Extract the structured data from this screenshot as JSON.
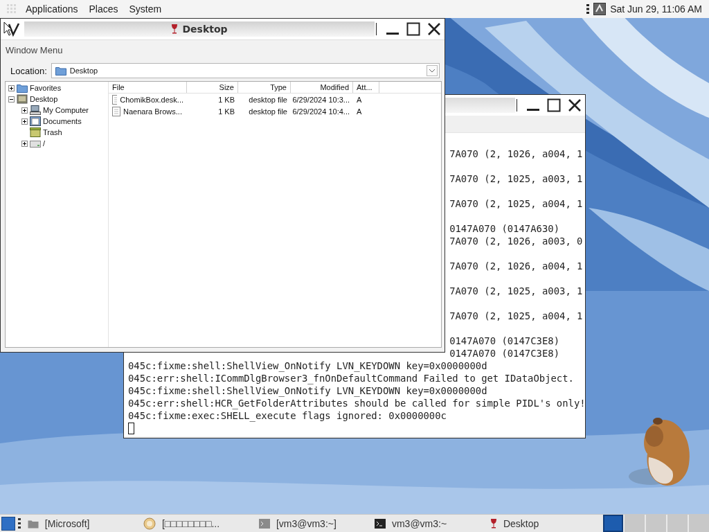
{
  "top_panel": {
    "menus": [
      "Applications",
      "Places",
      "System"
    ],
    "clock": "Sat Jun 29, 11:06 AM"
  },
  "file_window": {
    "title": "Desktop",
    "menu": "Window Menu",
    "location_label": "Location:",
    "location": "Desktop",
    "tree": [
      {
        "label": "Favorites",
        "kind": "folder",
        "expanded": false
      },
      {
        "label": "Desktop",
        "kind": "desktop",
        "expanded": true,
        "children": [
          {
            "label": "My Computer",
            "kind": "computer",
            "expanded": false
          },
          {
            "label": "Documents",
            "kind": "documents",
            "expanded": false
          },
          {
            "label": "Trash",
            "kind": "trash"
          },
          {
            "label": "/",
            "kind": "drive",
            "expanded": false
          }
        ]
      }
    ],
    "columns": [
      "File",
      "Size",
      "Type",
      "Modified",
      "Att..."
    ],
    "rows": [
      {
        "file": "ChomikBox.desk...",
        "size": "1 KB",
        "type": "desktop file",
        "modified": "6/29/2024 10:3...",
        "attributes": "A"
      },
      {
        "file": "Naenara Brows...",
        "size": "1 KB",
        "type": "desktop file",
        "modified": "6/29/2024 10:4...",
        "attributes": "A"
      }
    ]
  },
  "terminal": {
    "lines": [
      {
        "kind": "wrapped",
        "text": "7A070 (2, 1026, a004, 1"
      },
      {
        "kind": "wrapped",
        "text": "7A070 (2, 1025, a003, 1"
      },
      {
        "kind": "wrapped",
        "text": "7A070 (2, 1025, a004, 1"
      },
      {
        "kind": "wrapped",
        "text": "0147A070 (0147A630)"
      },
      {
        "kind": "tail",
        "text": "7A070 (2, 1026, a003, 0"
      },
      {
        "kind": "wrapped",
        "text": "7A070 (2, 1026, a004, 1"
      },
      {
        "kind": "wrapped",
        "text": "7A070 (2, 1025, a003, 1"
      },
      {
        "kind": "wrapped",
        "text": "7A070 (2, 1025, a004, 1"
      },
      {
        "kind": "wrapped",
        "text": "0147A070 (0147C3E8)"
      },
      {
        "kind": "tail",
        "text": "0147A070 (0147C3E8)"
      },
      {
        "kind": "line",
        "text": "045c:fixme:shell:ShellView_OnNotify LVN_KEYDOWN key=0x0000000d"
      },
      {
        "kind": "line",
        "text": "045c:err:shell:ICommDlgBrowser3_fnOnDefaultCommand Failed to get IDataObject."
      },
      {
        "kind": "line",
        "text": "045c:fixme:shell:ShellView_OnNotify LVN_KEYDOWN key=0x0000000d"
      },
      {
        "kind": "line",
        "text": "045c:err:shell:HCR_GetFolderAttributes should be called for simple PIDL's only!"
      },
      {
        "kind": "line",
        "text": "045c:fixme:exec:SHELL_execute flags ignored: 0x0000000c"
      }
    ]
  },
  "taskbar": {
    "tasks": [
      {
        "kind": "folder",
        "label": "[Microsoft]"
      },
      {
        "kind": "wine",
        "label": "[□□□□□□□□..."
      },
      {
        "kind": "terminal-dim",
        "label": "[vm3@vm3:~]"
      },
      {
        "kind": "terminal",
        "label": "vm3@vm3:~"
      },
      {
        "kind": "glass",
        "label": "Desktop"
      }
    ],
    "workspaces": [
      {
        "selected": true
      },
      {
        "selected": false
      },
      {
        "selected": false
      },
      {
        "selected": false
      },
      {
        "selected": false
      }
    ]
  }
}
